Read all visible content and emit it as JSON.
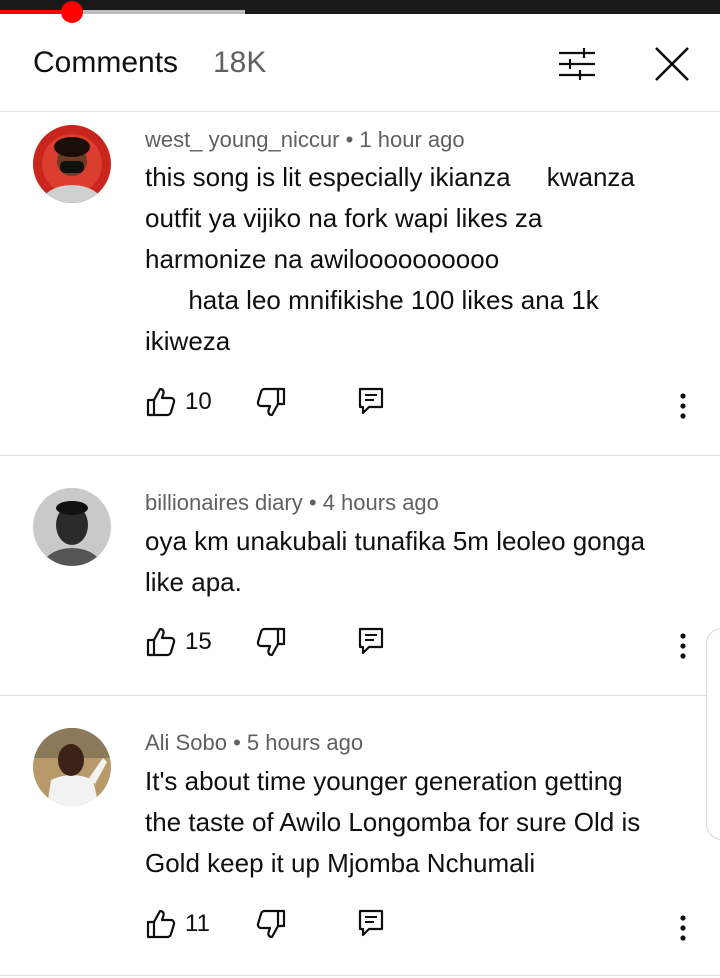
{
  "player": {
    "progress": 0.1,
    "buffered": 0.34
  },
  "header": {
    "title": "Comments",
    "count": "18K",
    "filter_icon": "filter-icon",
    "close_icon": "close-icon"
  },
  "comments": [
    {
      "author": "west_ young_niccur",
      "time": "1 hour ago",
      "lines": [
        "this song is lit especially ikianza     kwanza",
        "outfit ya vijiko na fork wapi likes za",
        "harmonize na awiloooooooooo",
        "      hata leo mnifikishe 100 likes ana 1k",
        "ikiweza"
      ],
      "likes": "10"
    },
    {
      "author": "billionaires diary",
      "time": "4 hours ago",
      "lines": [
        "oya km unakubali tunafika 5m leoleo gonga",
        "like apa."
      ],
      "likes": "15"
    },
    {
      "author": "Ali Sobo",
      "time": "5 hours ago",
      "lines": [
        "It's about time younger generation getting",
        "the taste of Awilo Longomba for sure Old is",
        "Gold keep it up Mjomba Nchumali"
      ],
      "likes": "11"
    }
  ],
  "colors": {
    "accent": "#ff0000",
    "secondary_text": "#606060",
    "primary_text": "#0f0f0f",
    "divider": "#e0e0e0"
  }
}
